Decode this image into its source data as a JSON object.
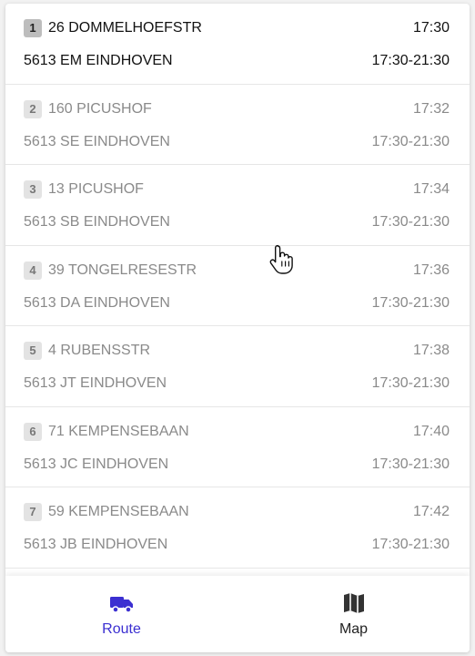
{
  "stops": [
    {
      "num": "1",
      "street": "26 DOMMELHOEFSTR",
      "city": "5613 EM EINDHOVEN",
      "time": "17:30",
      "window": "17:30-21:30",
      "active": true
    },
    {
      "num": "2",
      "street": "160 PICUSHOF",
      "city": "5613 SE EINDHOVEN",
      "time": "17:32",
      "window": "17:30-21:30",
      "active": false
    },
    {
      "num": "3",
      "street": "13 PICUSHOF",
      "city": "5613 SB EINDHOVEN",
      "time": "17:34",
      "window": "17:30-21:30",
      "active": false
    },
    {
      "num": "4",
      "street": "39 TONGELRESESTR",
      "city": "5613 DA EINDHOVEN",
      "time": "17:36",
      "window": "17:30-21:30",
      "active": false
    },
    {
      "num": "5",
      "street": "4 RUBENSSTR",
      "city": "5613 JT EINDHOVEN",
      "time": "17:38",
      "window": "17:30-21:30",
      "active": false
    },
    {
      "num": "6",
      "street": "71 KEMPENSEBAAN",
      "city": "5613 JC EINDHOVEN",
      "time": "17:40",
      "window": "17:30-21:30",
      "active": false
    },
    {
      "num": "7",
      "street": "59 KEMPENSEBAAN",
      "city": "5613 JB EINDHOVEN",
      "time": "17:42",
      "window": "17:30-21:30",
      "active": false
    }
  ],
  "nav": {
    "route": {
      "label": "Route",
      "icon": "truck-icon"
    },
    "map": {
      "label": "Map",
      "icon": "map-icon"
    }
  },
  "colors": {
    "accent": "#3b2fd1",
    "text": "#111111",
    "muted": "#8a8a8a"
  }
}
